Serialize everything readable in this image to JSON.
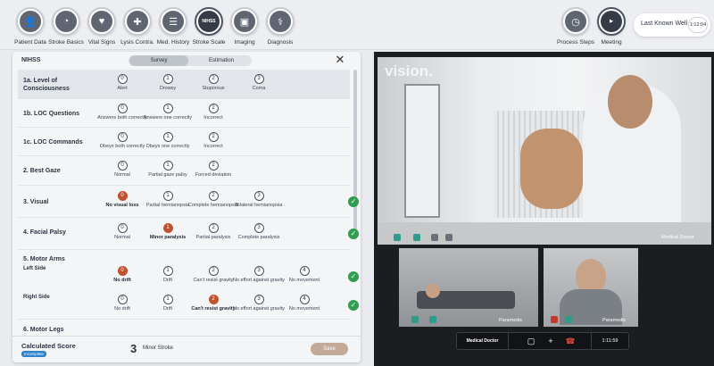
{
  "nav": {
    "items": [
      {
        "label": "Patient Data",
        "icon": "person-icon"
      },
      {
        "label": "Stroke Basics",
        "icon": "gauge-icon"
      },
      {
        "label": "Vital Signs",
        "icon": "heart-icon"
      },
      {
        "label": "Lysis Contra.",
        "icon": "syringe-icon"
      },
      {
        "label": "Med. History",
        "icon": "clipboard-icon"
      },
      {
        "label": "Stroke Scale",
        "icon": "nihss-icon",
        "badge": "NIHSS"
      },
      {
        "label": "Imaging",
        "icon": "image-icon"
      },
      {
        "label": "Diagnosis",
        "icon": "diagnosis-icon"
      }
    ],
    "right_items": [
      {
        "label": "Process Steps",
        "icon": "clock-icon"
      },
      {
        "label": "Meeting",
        "icon": "video-icon"
      }
    ],
    "last_known_well": {
      "label": "Last Known Well",
      "value": "1:12:04"
    }
  },
  "panel": {
    "title": "NIHSS",
    "tabs": [
      "Survey",
      "Estimation"
    ],
    "rows": [
      {
        "label": "1a. Level of Consciousness",
        "options": [
          {
            "n": "0",
            "t": "Alert"
          },
          {
            "n": "1",
            "t": "Drowsy"
          },
          {
            "n": "2",
            "t": "Stuporous"
          },
          {
            "n": "3",
            "t": "Coma"
          }
        ]
      },
      {
        "label": "1b. LOC Questions",
        "options": [
          {
            "n": "0",
            "t": "Answers both correctly"
          },
          {
            "n": "1",
            "t": "Answers one correctly"
          },
          {
            "n": "2",
            "t": "Incorrect"
          }
        ]
      },
      {
        "label": "1c. LOC Commands",
        "options": [
          {
            "n": "0",
            "t": "Obeys both correctly"
          },
          {
            "n": "1",
            "t": "Obeys one correctly"
          },
          {
            "n": "2",
            "t": "Incorrect"
          }
        ]
      },
      {
        "label": "2. Best Gaze",
        "options": [
          {
            "n": "0",
            "t": "Normal"
          },
          {
            "n": "1",
            "t": "Partial gaze palsy"
          },
          {
            "n": "2",
            "t": "Forced deviation"
          }
        ]
      },
      {
        "label": "3. Visual",
        "options": [
          {
            "n": "0",
            "t": "No visual loss"
          },
          {
            "n": "1",
            "t": "Partial hemianopsia"
          },
          {
            "n": "2",
            "t": "Complete hemianopsia"
          },
          {
            "n": "3",
            "t": "Bilateral hemianopsia"
          }
        ]
      },
      {
        "label": "4. Facial Palsy",
        "options": [
          {
            "n": "0",
            "t": "Normal"
          },
          {
            "n": "1",
            "t": "Minor paralysis"
          },
          {
            "n": "2",
            "t": "Partial paralysis"
          },
          {
            "n": "3",
            "t": "Complete paralysis"
          }
        ]
      },
      {
        "label": "5. Motor Arms",
        "sub": [
          {
            "label": "Left Side",
            "options": [
              {
                "n": "0",
                "t": "No drift"
              },
              {
                "n": "1",
                "t": "Drift"
              },
              {
                "n": "2",
                "t": "Can't resist gravity"
              },
              {
                "n": "3",
                "t": "No effort against gravity"
              },
              {
                "n": "4",
                "t": "No movement"
              }
            ]
          },
          {
            "label": "Right Side",
            "options": [
              {
                "n": "0",
                "t": "No drift"
              },
              {
                "n": "1",
                "t": "Drift"
              },
              {
                "n": "2",
                "t": "Can't resist gravity"
              },
              {
                "n": "3",
                "t": "No effort against gravity"
              },
              {
                "n": "4",
                "t": "No movement"
              }
            ]
          }
        ]
      },
      {
        "label": "6. Motor Legs"
      }
    ]
  },
  "footer": {
    "label": "Calculated Score",
    "badge": "Incomplete",
    "score": "3",
    "severity": "Minor Stroke",
    "save": "Save"
  },
  "video": {
    "brand": "vision.",
    "main_tag": "Medical Doctor",
    "sub1_tag": "Paramedic",
    "sub2_tag": "Paramedic",
    "callbar": {
      "who": "Medical Doctor",
      "timer": "1:11:59"
    }
  },
  "colors": {
    "selected": "#c0522d",
    "check": "#2e9e4f",
    "badge": "#2f83c8",
    "save": "#c3a998"
  }
}
